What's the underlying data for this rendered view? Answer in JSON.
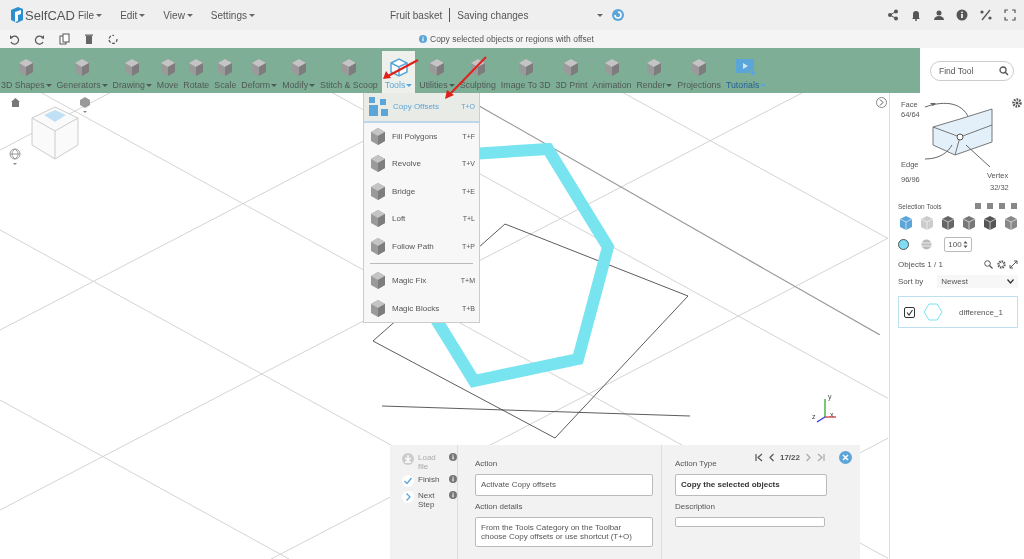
{
  "header": {
    "logo": "SelfCAD",
    "menus": [
      "File",
      "Edit",
      "View",
      "Settings"
    ],
    "document_title": "Fruit basket",
    "save_status": "Saving changes"
  },
  "quick_bar": {
    "hint": "Copy selected objects or regions with offset"
  },
  "toolbar": {
    "items": [
      {
        "label": "3D Shapes",
        "dropdown": true,
        "selected": false,
        "accent": false
      },
      {
        "label": "Generators",
        "dropdown": true,
        "selected": false,
        "accent": false
      },
      {
        "label": "Drawing",
        "dropdown": true,
        "selected": false,
        "accent": false
      },
      {
        "label": "Move",
        "dropdown": false,
        "selected": false,
        "accent": false
      },
      {
        "label": "Rotate",
        "dropdown": false,
        "selected": false,
        "accent": false
      },
      {
        "label": "Scale",
        "dropdown": false,
        "selected": false,
        "accent": false
      },
      {
        "label": "Deform",
        "dropdown": true,
        "selected": false,
        "accent": false
      },
      {
        "label": "Modify",
        "dropdown": true,
        "selected": false,
        "accent": false
      },
      {
        "label": "Stitch & Scoop",
        "dropdown": false,
        "selected": false,
        "accent": false
      },
      {
        "label": "Tools",
        "dropdown": true,
        "selected": true,
        "accent": false
      },
      {
        "label": "Utilities",
        "dropdown": true,
        "selected": false,
        "accent": false
      },
      {
        "label": "Sculpting",
        "dropdown": false,
        "selected": false,
        "accent": false
      },
      {
        "label": "Image To 3D",
        "dropdown": false,
        "selected": false,
        "accent": false
      },
      {
        "label": "3D Print",
        "dropdown": false,
        "selected": false,
        "accent": false
      },
      {
        "label": "Animation",
        "dropdown": false,
        "selected": false,
        "accent": false
      },
      {
        "label": "Render",
        "dropdown": true,
        "selected": false,
        "accent": false
      },
      {
        "label": "Projections",
        "dropdown": false,
        "selected": false,
        "accent": false
      },
      {
        "label": "Tutorials",
        "dropdown": true,
        "selected": false,
        "accent": true
      }
    ]
  },
  "find_tool": {
    "placeholder": "Find Tool"
  },
  "tools_menu": {
    "groups": [
      [
        {
          "label": "Copy Offsets",
          "shortcut": "T+O",
          "selected": true
        },
        {
          "label": "Fill Polygons",
          "shortcut": "T+F",
          "selected": false
        },
        {
          "label": "Revolve",
          "shortcut": "T+V",
          "selected": false
        },
        {
          "label": "Bridge",
          "shortcut": "T+E",
          "selected": false
        },
        {
          "label": "Loft",
          "shortcut": "T+L",
          "selected": false
        },
        {
          "label": "Follow Path",
          "shortcut": "T+P",
          "selected": false
        }
      ],
      [
        {
          "label": "Magic Fix",
          "shortcut": "T+M",
          "selected": false
        },
        {
          "label": "Magic Blocks",
          "shortcut": "T+B",
          "selected": false
        }
      ]
    ]
  },
  "viewport": {
    "axes": [
      "z",
      "x",
      "y"
    ]
  },
  "side_panel": {
    "face": {
      "label": "Face",
      "count": "64/64"
    },
    "edge": {
      "label": "Edge",
      "count": "96/96"
    },
    "vertex": {
      "label": "Vertex",
      "count": "32/32"
    },
    "selection_tools_label": "Selection Tools",
    "opacity": "100",
    "objects_label": "Objects 1 / 1",
    "sort_label": "Sort by",
    "sort_value": "Newest",
    "objects": [
      {
        "name": "difference_1",
        "checked": true
      }
    ]
  },
  "tutorial": {
    "pager": "17/22",
    "steps": [
      {
        "kind": "load",
        "label": "Load file",
        "disabled": true
      },
      {
        "kind": "finish",
        "label": "Finish",
        "disabled": false
      },
      {
        "kind": "next",
        "label": "Next Step",
        "disabled": false
      }
    ],
    "action_label": "Action",
    "action": "Activate Copy offsets",
    "details_label": "Action details",
    "details": "From the Tools Category on the Toolbar choose Copy offsets or use shortcut  (T+O)",
    "type_label": "Action Type",
    "type": "Copy the selected objects",
    "description_label": "Description"
  }
}
